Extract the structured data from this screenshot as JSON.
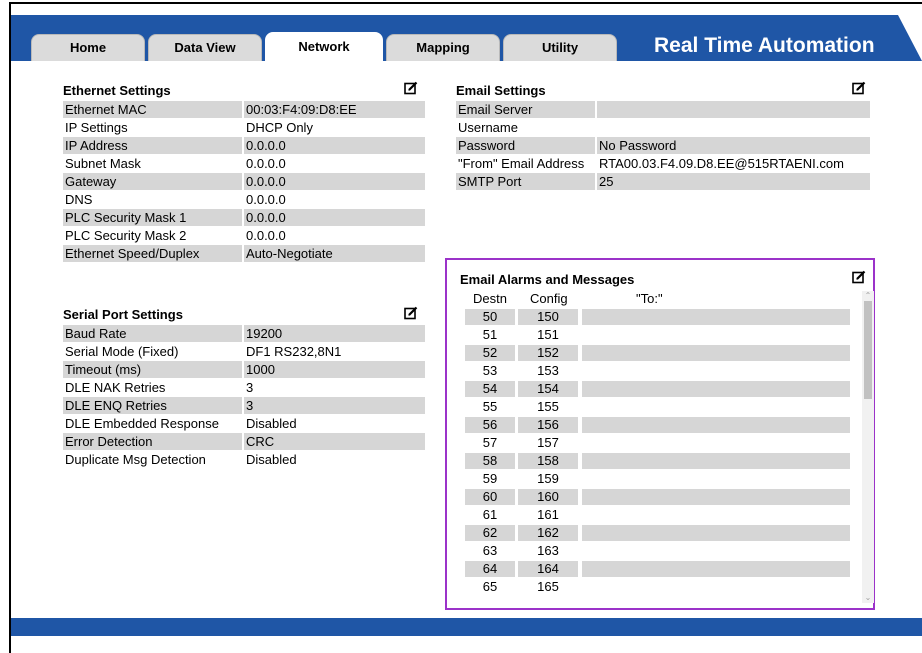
{
  "tabs": [
    {
      "label": "Home"
    },
    {
      "label": "Data View"
    },
    {
      "label": "Network"
    },
    {
      "label": "Mapping"
    },
    {
      "label": "Utility"
    }
  ],
  "active_tab": "Network",
  "brand": "Real Time Automation",
  "colors": {
    "header_blue": "#1f56a6",
    "highlight_border": "#9b32c9",
    "row_shade": "#d6d6d6"
  },
  "ethernet": {
    "title": "Ethernet Settings",
    "rows": [
      {
        "label": "Ethernet MAC",
        "value": "00:03:F4:09:D8:EE"
      },
      {
        "label": "IP Settings",
        "value": "DHCP Only"
      },
      {
        "label": "IP Address",
        "value": "0.0.0.0"
      },
      {
        "label": "Subnet Mask",
        "value": "0.0.0.0"
      },
      {
        "label": "Gateway",
        "value": "0.0.0.0"
      },
      {
        "label": "DNS",
        "value": "0.0.0.0"
      },
      {
        "label": "PLC Security Mask 1",
        "value": "0.0.0.0"
      },
      {
        "label": "PLC Security Mask 2",
        "value": "0.0.0.0"
      },
      {
        "label": "Ethernet Speed/Duplex",
        "value": "Auto-Negotiate"
      }
    ]
  },
  "serial": {
    "title": "Serial Port Settings",
    "rows": [
      {
        "label": "Baud Rate",
        "value": "19200"
      },
      {
        "label": "Serial Mode (Fixed)",
        "value": "DF1 RS232,8N1"
      },
      {
        "label": "Timeout (ms)",
        "value": "1000"
      },
      {
        "label": "DLE NAK Retries",
        "value": "3"
      },
      {
        "label": "DLE ENQ Retries",
        "value": "3"
      },
      {
        "label": "DLE Embedded Response",
        "value": "Disabled"
      },
      {
        "label": "Error Detection",
        "value": "CRC"
      },
      {
        "label": "Duplicate Msg Detection",
        "value": "Disabled"
      }
    ]
  },
  "email": {
    "title": "Email Settings",
    "rows": [
      {
        "label": "Email Server",
        "value": ""
      },
      {
        "label": "Username",
        "value": ""
      },
      {
        "label": "Password",
        "value": "No Password"
      },
      {
        "label": "\"From\" Email Address",
        "value": "RTA00.03.F4.09.D8.EE@515RTAENI.com"
      },
      {
        "label": "SMTP Port",
        "value": "25"
      }
    ]
  },
  "alarms": {
    "title": "Email Alarms and Messages",
    "col_destn": "Destn",
    "col_config": "Config",
    "col_to": "\"To:\"",
    "rows": [
      {
        "destn": "50",
        "config": "150",
        "to": ""
      },
      {
        "destn": "51",
        "config": "151",
        "to": ""
      },
      {
        "destn": "52",
        "config": "152",
        "to": ""
      },
      {
        "destn": "53",
        "config": "153",
        "to": ""
      },
      {
        "destn": "54",
        "config": "154",
        "to": ""
      },
      {
        "destn": "55",
        "config": "155",
        "to": ""
      },
      {
        "destn": "56",
        "config": "156",
        "to": ""
      },
      {
        "destn": "57",
        "config": "157",
        "to": ""
      },
      {
        "destn": "58",
        "config": "158",
        "to": ""
      },
      {
        "destn": "59",
        "config": "159",
        "to": ""
      },
      {
        "destn": "60",
        "config": "160",
        "to": ""
      },
      {
        "destn": "61",
        "config": "161",
        "to": ""
      },
      {
        "destn": "62",
        "config": "162",
        "to": ""
      },
      {
        "destn": "63",
        "config": "163",
        "to": ""
      },
      {
        "destn": "64",
        "config": "164",
        "to": ""
      },
      {
        "destn": "65",
        "config": "165",
        "to": ""
      }
    ]
  }
}
